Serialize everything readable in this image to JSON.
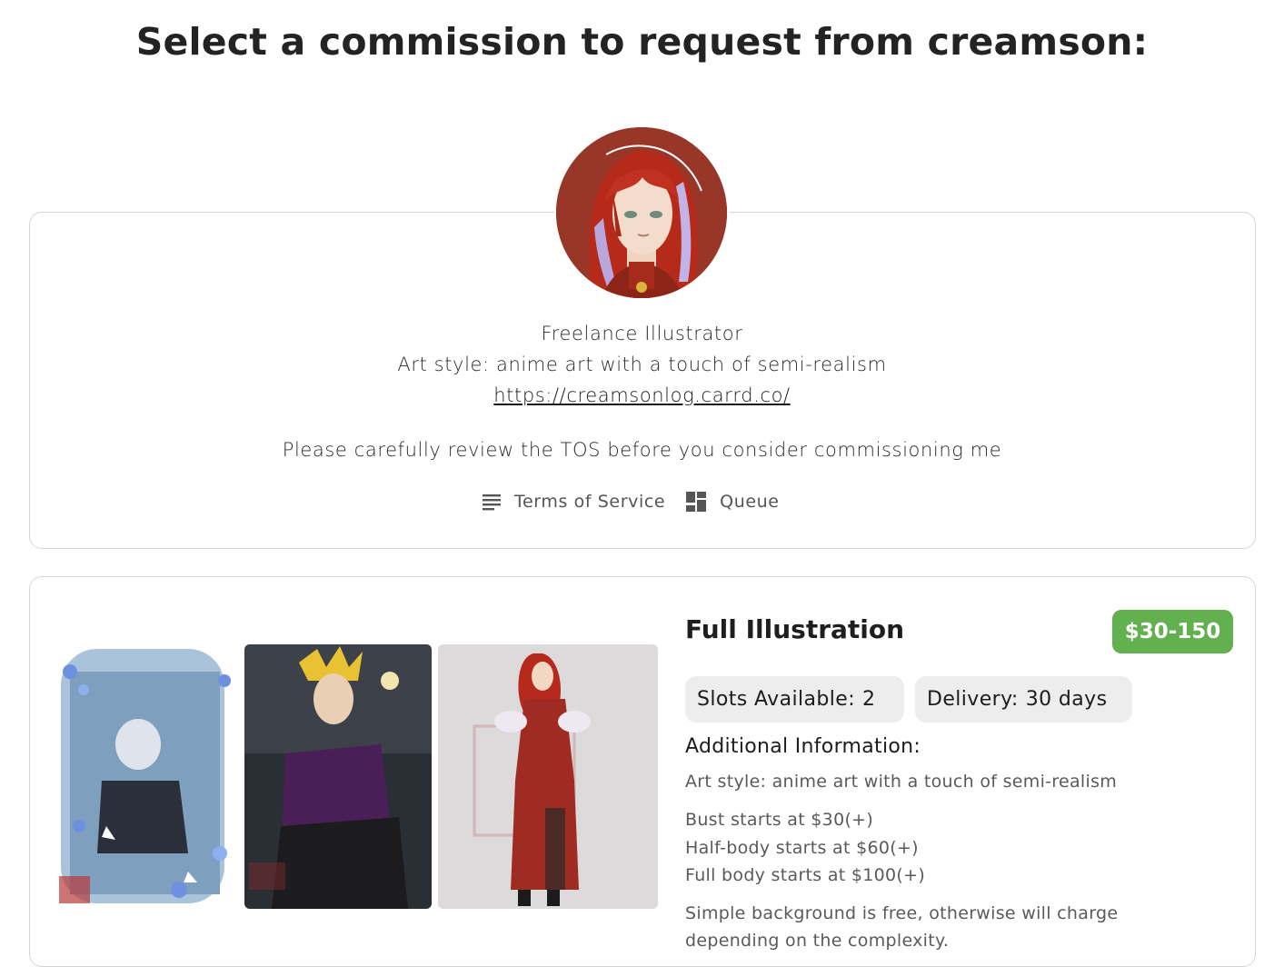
{
  "page": {
    "title": "Select a commission to request from creamson:"
  },
  "profile": {
    "bio_line1": "Freelance Illustrator",
    "bio_line2": "Art style: anime art with a touch of semi-realism",
    "link": "https://creamsonlog.carrd.co/",
    "note": "Please carefully review the TOS before you consider commissioning me",
    "links": [
      {
        "label": "Terms of Service",
        "icon": "list-lines-icon"
      },
      {
        "label": "Queue",
        "icon": "dashboard-grid-icon"
      }
    ]
  },
  "commission": {
    "title": "Full Illustration",
    "price": "$30-150",
    "slots_label": "Slots Available:",
    "slots_value": "2",
    "delivery_label": "Delivery:",
    "delivery_value": "30 days",
    "additional_heading": "Additional Information:",
    "info": [
      "Art style: anime art with a touch of semi-realism",
      "Bust starts at $30(+)",
      "Half-body starts at $60(+)",
      "Full body starts at $100(+)",
      "Simple background is free, otherwise will charge depending on the complexity."
    ]
  },
  "colors": {
    "price_badge": "#63b04f",
    "chip_bg": "#ededed",
    "card_border": "#d6d6d6"
  }
}
